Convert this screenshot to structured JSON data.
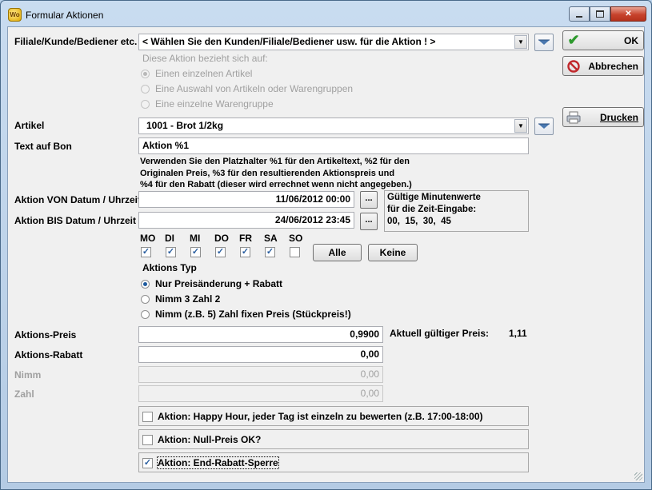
{
  "window": {
    "title": "Formular Aktionen",
    "icon": "app-wo-icon",
    "min_icon": "minimize-icon",
    "max_icon": "maximize-icon",
    "close_icon": "close-icon"
  },
  "buttons": {
    "ok": "OK",
    "cancel": "Abbrechen",
    "print": "Drucken",
    "all": "Alle",
    "none": "Keine",
    "ellipsis": "..."
  },
  "customer": {
    "label": "Filiale/Kunde/Bediener etc.",
    "value": "< Wählen Sie den Kunden/Filiale/Bediener usw. für die Aktion ! >",
    "scope_heading": "Diese Aktion bezieht sich auf:",
    "scope_options": [
      {
        "label": "Einen einzelnen Artikel",
        "selected": true
      },
      {
        "label": "Eine Auswahl von Artikeln oder Warengruppen",
        "selected": false
      },
      {
        "label": "Eine einzelne Warengruppe",
        "selected": false
      }
    ]
  },
  "article": {
    "label": "Artikel",
    "value": "1001 - Brot 1/2kg"
  },
  "receipt": {
    "label": "Text auf Bon",
    "value": "Aktion %1",
    "help": [
      "Verwenden Sie den Platzhalter %1 für den Artikeltext, %2 für den",
      "Originalen Preis, %3 für den resultierenden Aktionspreis und",
      "%4 für den Rabatt (dieser wird errechnet wenn nicht angegeben.)"
    ]
  },
  "dates": {
    "from_label": "Aktion VON Datum / Uhrzeit",
    "from_value": "11/06/2012 00:00",
    "to_label": "Aktion BIS Datum / Uhrzeit",
    "to_value": "24/06/2012 23:45",
    "minutes_info": [
      "Gültige Minutenwerte",
      "für die Zeit-Eingabe:",
      "00,  15,  30,  45"
    ]
  },
  "weekdays": [
    {
      "label": "MO",
      "checked": true
    },
    {
      "label": "DI",
      "checked": true
    },
    {
      "label": "MI",
      "checked": true
    },
    {
      "label": "DO",
      "checked": true
    },
    {
      "label": "FR",
      "checked": true
    },
    {
      "label": "SA",
      "checked": true
    },
    {
      "label": "SO",
      "checked": false
    }
  ],
  "action_type": {
    "heading": "Aktions Typ",
    "options": [
      {
        "label": "Nur Preisänderung + Rabatt",
        "selected": true
      },
      {
        "label": "Nimm 3 Zahl 2",
        "selected": false
      },
      {
        "label": "Nimm (z.B. 5) Zahl fixen Preis (Stückpreis!)",
        "selected": false
      }
    ]
  },
  "price": {
    "price_label": "Aktions-Preis",
    "price_value": "0,9900",
    "current_label": "Aktuell gültiger Preis:",
    "current_value": "1,11",
    "discount_label": "Aktions-Rabatt",
    "discount_value": "0,00",
    "take_label": "Nimm",
    "take_value": "0,00",
    "pay_label": "Zahl",
    "pay_value": "0,00"
  },
  "options": [
    {
      "label": "Aktion: Happy Hour, jeder Tag ist einzeln zu bewerten (z.B. 17:00-18:00)",
      "checked": false
    },
    {
      "label": "Aktion: Null-Preis OK?",
      "checked": false
    },
    {
      "label": "Aktion: End-Rabatt-Sperre",
      "checked": true
    }
  ],
  "colors": {
    "ok_check": "#2e9a2e",
    "cancel_icon": "#c0282c",
    "radio_dot": "#1d5a9e"
  }
}
